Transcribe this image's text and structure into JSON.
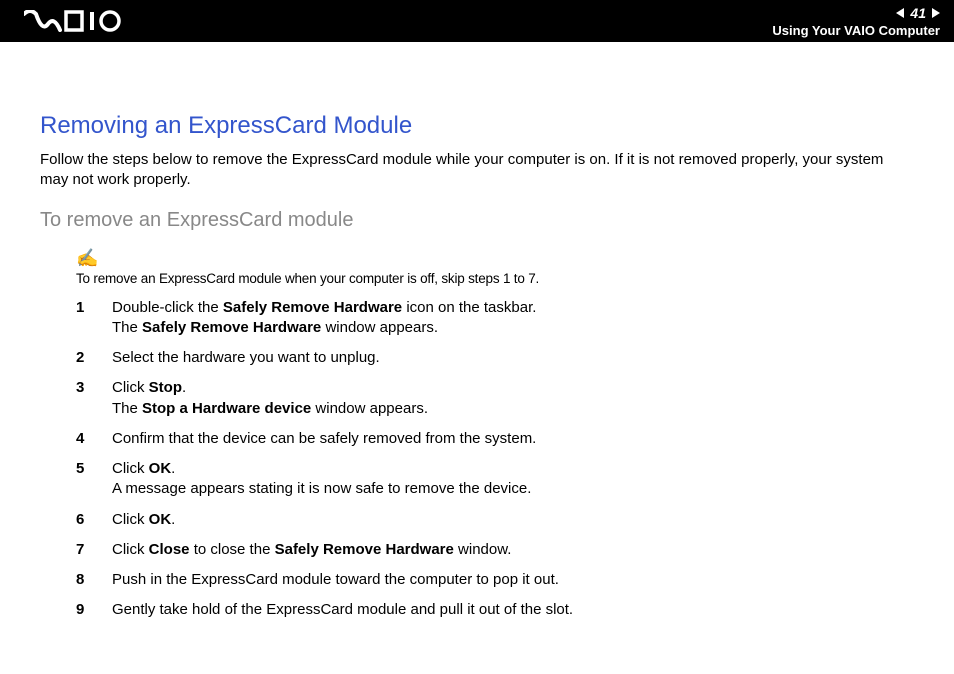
{
  "header": {
    "page_number": "41",
    "breadcrumb": "Using Your VAIO Computer"
  },
  "content": {
    "heading": "Removing an ExpressCard Module",
    "intro": "Follow the steps below to remove the ExpressCard module while your computer is on. If it is not removed properly, your system may not work properly.",
    "subheading": "To remove an ExpressCard module",
    "note": "To remove an ExpressCard module when your computer is off, skip steps 1 to 7.",
    "steps": {
      "s1_a": "Double-click the ",
      "s1_b": "Safely Remove Hardware",
      "s1_c": " icon on the taskbar.",
      "s1_d": "The ",
      "s1_e": "Safely Remove Hardware",
      "s1_f": " window appears.",
      "s2": "Select the hardware you want to unplug.",
      "s3_a": "Click ",
      "s3_b": "Stop",
      "s3_c": ".",
      "s3_d": "The ",
      "s3_e": "Stop a Hardware device",
      "s3_f": " window appears.",
      "s4": "Confirm that the device can be safely removed from the system.",
      "s5_a": "Click ",
      "s5_b": "OK",
      "s5_c": ".",
      "s5_d": "A message appears stating it is now safe to remove the device.",
      "s6_a": "Click ",
      "s6_b": "OK",
      "s6_c": ".",
      "s7_a": "Click ",
      "s7_b": "Close",
      "s7_c": " to close the ",
      "s7_d": "Safely Remove Hardware",
      "s7_e": " window.",
      "s8": "Push in the ExpressCard module toward the computer to pop it out.",
      "s9": "Gently take hold of the ExpressCard module and pull it out of the slot."
    },
    "nums": {
      "n1": "1",
      "n2": "2",
      "n3": "3",
      "n4": "4",
      "n5": "5",
      "n6": "6",
      "n7": "7",
      "n8": "8",
      "n9": "9"
    }
  }
}
